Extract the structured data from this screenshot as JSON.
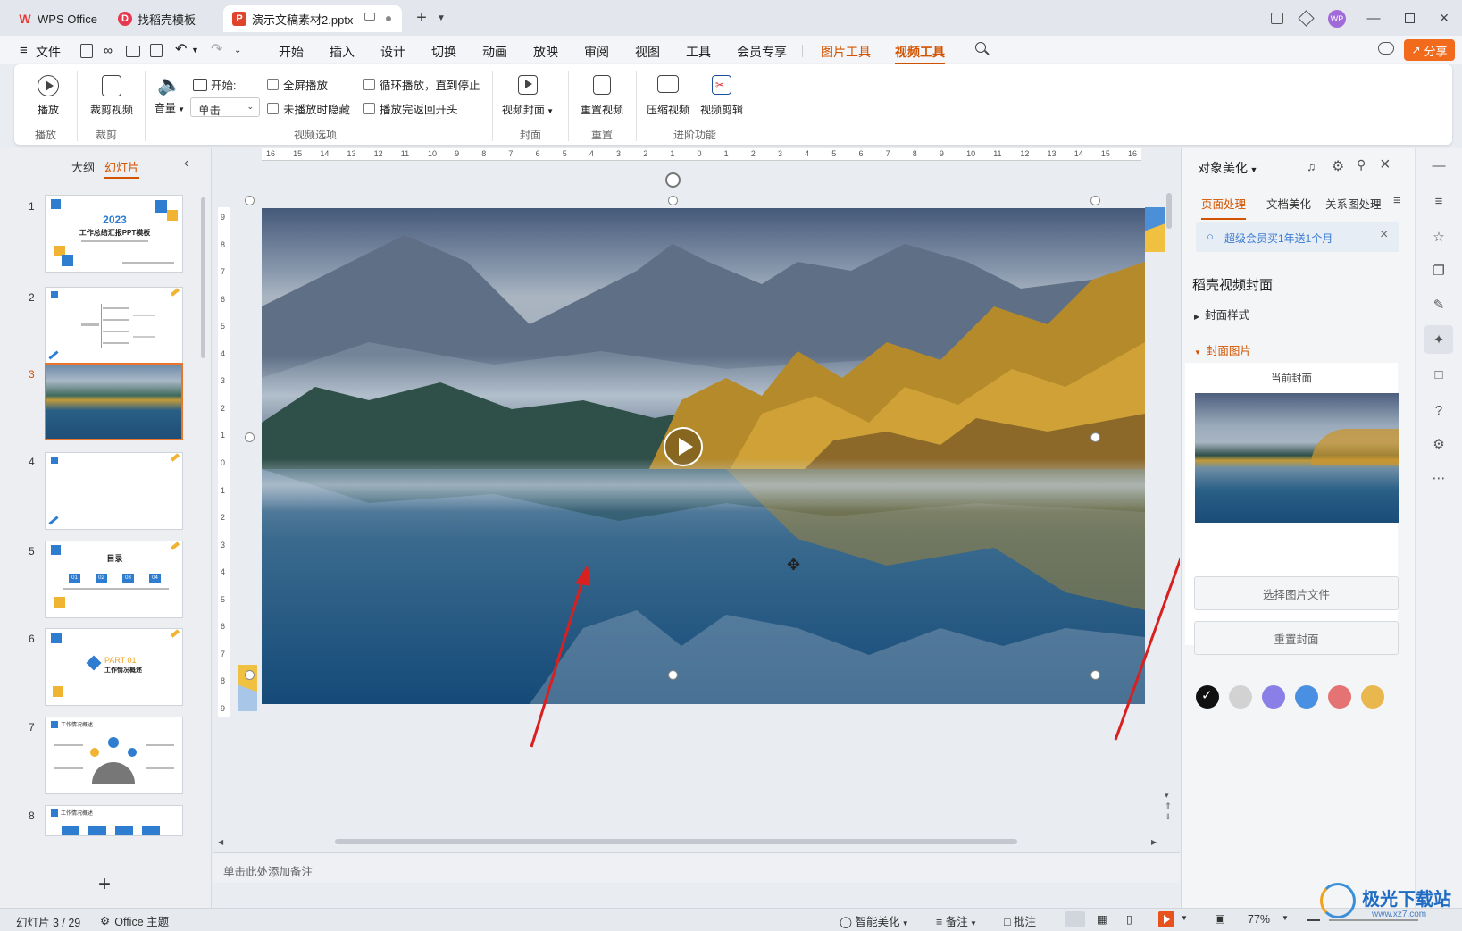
{
  "tabs": [
    {
      "label": "WPS Office",
      "icon": "wps-logo-icon"
    },
    {
      "label": "找稻壳模板",
      "icon": "docer-icon"
    },
    {
      "label": "演示文稿素材2.pptx",
      "icon": "ppt-file-icon"
    }
  ],
  "avatar_text": "WP",
  "share_label": "分享",
  "menu": {
    "file": "文件",
    "items": [
      "开始",
      "插入",
      "设计",
      "切换",
      "动画",
      "放映",
      "审阅",
      "视图",
      "工具",
      "会员专享"
    ],
    "picture_tools": "图片工具",
    "video_tools": "视频工具"
  },
  "ribbon": {
    "play": "播放",
    "crop_video": "裁剪视频",
    "volume": "音量",
    "start_label": "开始:",
    "start_value": "单击",
    "fullscreen": "全屏播放",
    "hide_not_playing": "未播放时隐藏",
    "loop": "循环播放，直到停止",
    "rewind": "播放完返回开头",
    "video_cover": "视频封面",
    "reset_video": "重置视频",
    "compress_video": "压缩视频",
    "video_edit": "视频剪辑",
    "groups": {
      "play": "播放",
      "crop": "裁剪",
      "options": "视频选项",
      "cover": "封面",
      "reset": "重置",
      "advanced": "进阶功能"
    }
  },
  "left_pane": {
    "tab_outline": "大纲",
    "tab_slides": "幻灯片",
    "thumbnails": [
      {
        "num": "1",
        "title": "2023",
        "subtitle": "工作总结汇报PPT模板",
        "selected": false
      },
      {
        "num": "2",
        "title": "",
        "subtitle": "",
        "selected": false
      },
      {
        "num": "3",
        "title": "",
        "subtitle": "",
        "selected": true
      },
      {
        "num": "4",
        "title": "",
        "subtitle": "",
        "selected": false
      },
      {
        "num": "5",
        "title": "目录",
        "subtitle": "",
        "selected": false
      },
      {
        "num": "6",
        "title": "PART 01",
        "subtitle": "工作情况概述",
        "selected": false
      },
      {
        "num": "7",
        "title": "工作情况概述",
        "subtitle": "",
        "selected": false
      },
      {
        "num": "8",
        "title": "工作情况概述",
        "subtitle": "",
        "selected": false
      }
    ],
    "slide5_items": [
      "01",
      "02",
      "03",
      "04"
    ],
    "add_slide": "+"
  },
  "ruler_h": [
    "16",
    "15",
    "14",
    "13",
    "12",
    "11",
    "10",
    "9",
    "8",
    "7",
    "6",
    "5",
    "4",
    "3",
    "2",
    "1",
    "0",
    "1",
    "2",
    "3",
    "4",
    "5",
    "6",
    "7",
    "8",
    "9",
    "10",
    "11",
    "12",
    "13",
    "14",
    "15",
    "16"
  ],
  "ruler_v": [
    "9",
    "8",
    "7",
    "6",
    "5",
    "4",
    "3",
    "2",
    "1",
    "0",
    "1",
    "2",
    "3",
    "4",
    "5",
    "6",
    "7",
    "8",
    "9"
  ],
  "notes_placeholder": "单击此处添加备注",
  "right_pane": {
    "title": "对象美化",
    "tabs": [
      "页面处理",
      "文档美化",
      "关系图处理"
    ],
    "promo": "超级会员买1年送1个月",
    "section_title": "稻壳视频封面",
    "cover_style": "封面样式",
    "cover_image": "封面图片",
    "current_cover": "当前封面",
    "swatches": [
      "#111111",
      "#d2d2d2",
      "#8a7fe6",
      "#4a90e2",
      "#e57373",
      "#e8b84f"
    ],
    "select_file": "选择图片文件",
    "reset_cover": "重置封面"
  },
  "status": {
    "slide_info": "幻灯片 3 / 29",
    "theme": "Office 主题",
    "smart": "智能美化",
    "notes": "备注",
    "comments": "批注",
    "zoom": "77%"
  },
  "watermark": "极光下载站",
  "watermark_url": "www.xz7.com"
}
